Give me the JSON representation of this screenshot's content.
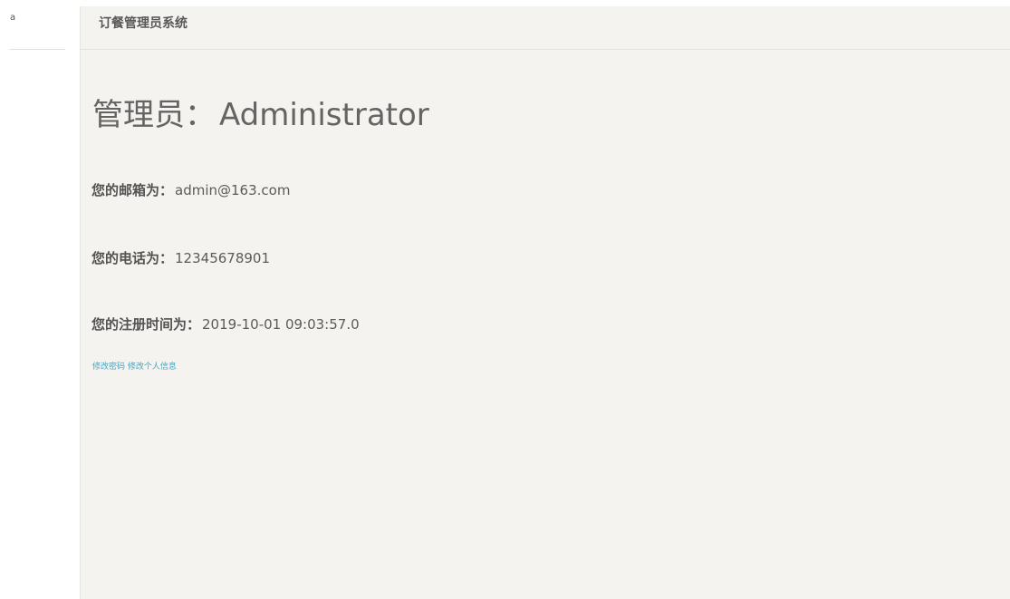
{
  "sidebar": {
    "fragment_text": "a"
  },
  "header": {
    "title": "订餐管理员系统"
  },
  "profile": {
    "heading_label": "管理员：",
    "heading_name": "Administrator",
    "email_label": "您的邮箱为：",
    "email_value": "admin@163.com",
    "phone_label": "您的电话为：",
    "phone_value": "12345678901",
    "register_label": "您的注册时间为：",
    "register_value": "2019-10-01 09:03:57.0"
  },
  "actions": {
    "change_password": "修改密码",
    "edit_profile": "修改个人信息"
  },
  "colors": {
    "main_background": "#f4f3f0",
    "link": "#4aa3bd",
    "text": "#5e5a59"
  }
}
